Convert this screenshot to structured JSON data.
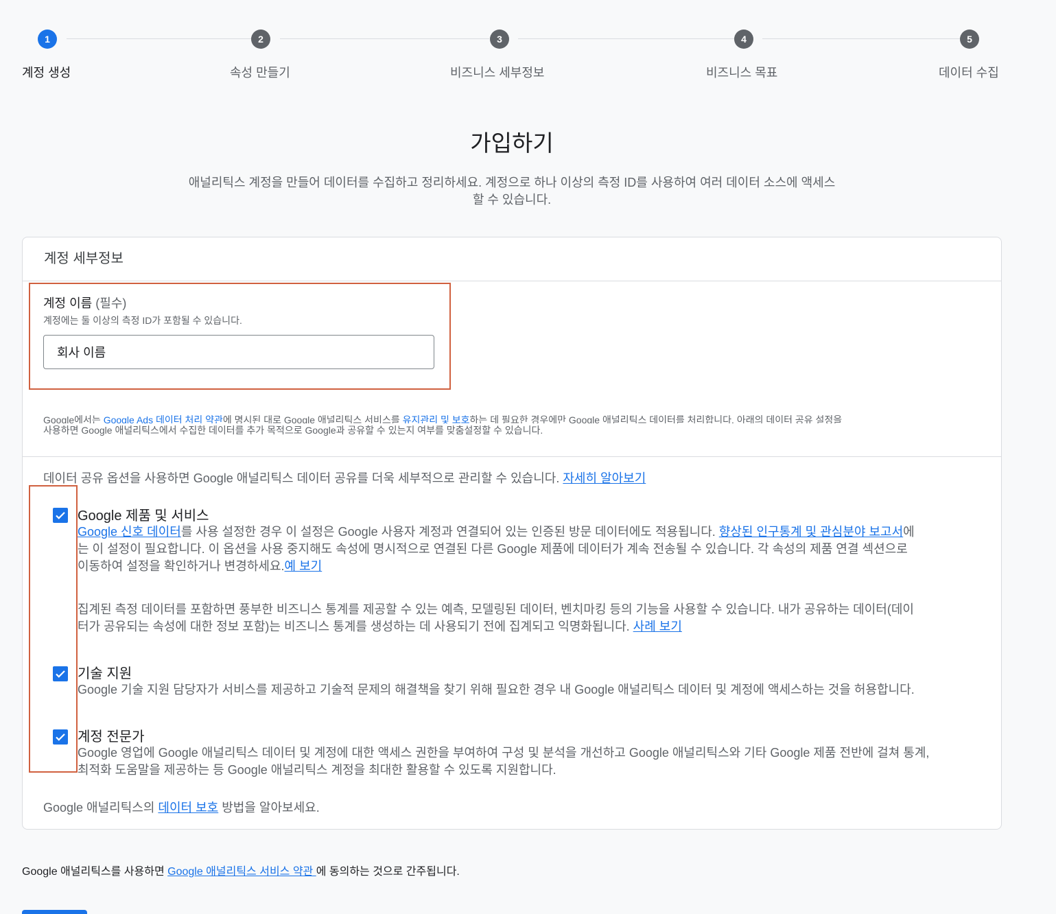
{
  "stepper": {
    "steps": [
      {
        "number": "1",
        "label": "계정 생성"
      },
      {
        "number": "2",
        "label": "속성 만들기"
      },
      {
        "number": "3",
        "label": "비즈니스 세부정보"
      },
      {
        "number": "4",
        "label": "비즈니스 목표"
      },
      {
        "number": "5",
        "label": "데이터 수집"
      }
    ]
  },
  "page": {
    "title": "가입하기",
    "subtitle_line1": "애널리틱스 계정을 만들어 데이터를 수집하고 정리하세요. 계정으로 하나 이상의 측정 ID를 사용하여 여러 데이터 소스에 액세스",
    "subtitle_line2": "할 수 있습니다."
  },
  "card": {
    "header": "계정 세부정보",
    "account_name": {
      "label": "계정 이름",
      "required": "(필수)",
      "hint": "계정에는 둘 이상의 측정 ID가 포함될 수 있습니다.",
      "value": "회사 이름"
    },
    "legal": {
      "line1_prefix": "Google에서는 ",
      "line1_link1": "Google Ads 데이터 처리 약관",
      "line1_mid": "에 명시된 대로 Google 애널리틱스 서비스를 ",
      "line1_link2": "유지관리 및 보호",
      "line1_suffix": "하는 데 필요한 경우에만 Google 애널리틱스 데이터를 처리합니다. 아래의 데이터 공유 설정을",
      "line2": "사용하면 Google 애널리틱스에서 수집한 데이터를 추가 목적으로 Google과 공유할 수 있는지 여부를 맞춤설정할 수 있습니다."
    },
    "sharing": {
      "intro": "데이터 공유 옵션을 사용하면 Google 애널리틱스 데이터 공유를 더욱 세부적으로 관리할 수 있습니다. ",
      "intro_link": "자세히 알아보기",
      "options": [
        {
          "title": "Google 제품 및 서비스",
          "checked": true,
          "link1": "Google 신호 데이터",
          "text1": "를 사용 설정한 경우 이 설정은 Google 사용자 계정과 연결되어 있는 인증된 방문 데이터에도 적용됩니다. ",
          "link2": "향상된 인구통계 및 관심분야 보고서",
          "text2": "에",
          "line2": "는 이 설정이 필요합니다. 이 옵션을 사용 중지해도 속성에 명시적으로 연결된 다른 Google 제품에 데이터가 계속 전송될 수 있습니다. 각 속성의 제품 연결 섹션으로",
          "line3": "이동하여 설정을 확인하거나 변경하세요.",
          "link3": "예 보기",
          "para2_line1": "집계된 측정 데이터를 포함하면 풍부한 비즈니스 통계를 제공할 수 있는 예측, 모델링된 데이터, 벤치마킹 등의 기능을 사용할 수 있습니다. 내가 공유하는 데이터(데이",
          "para2_line2": "터가 공유되는 속성에 대한 정보 포함)는 비즈니스 통계를 생성하는 데 사용되기 전에 집계되고 익명화됩니다. ",
          "para2_link": "사례 보기"
        },
        {
          "title": "기술 지원",
          "checked": true,
          "text": "Google 기술 지원 담당자가 서비스를 제공하고 기술적 문제의 해결책을 찾기 위해 필요한 경우 내 Google 애널리틱스 데이터 및 계정에 액세스하는 것을 허용합니다."
        },
        {
          "title": "계정 전문가",
          "checked": true,
          "line1": "Google 영업에 Google 애널리틱스 데이터 및 계정에 대한 액세스 권한을 부여하여 구성 및 분석을 개선하고 Google 애널리틱스와 기타 Google 제품 전반에 걸쳐 통계,",
          "line2": "최적화 도움말을 제공하는 등 Google 애널리틱스 계정을 최대한 활용할 수 있도록 지원합니다."
        }
      ]
    },
    "data_protection": {
      "prefix": "Google 애널리틱스의 ",
      "link": "데이터 보호",
      "suffix": " 방법을 알아보세요."
    }
  },
  "tos": {
    "prefix": "Google 애널리틱스를 사용하면 ",
    "link": "Google 애널리틱스 서비스 약관 ",
    "suffix": "에 동의하는 것으로 간주됩니다."
  },
  "colors": {
    "accent": "#1a73e8",
    "highlight_box": "#d0603f",
    "inactive_step": "#5f6368"
  }
}
